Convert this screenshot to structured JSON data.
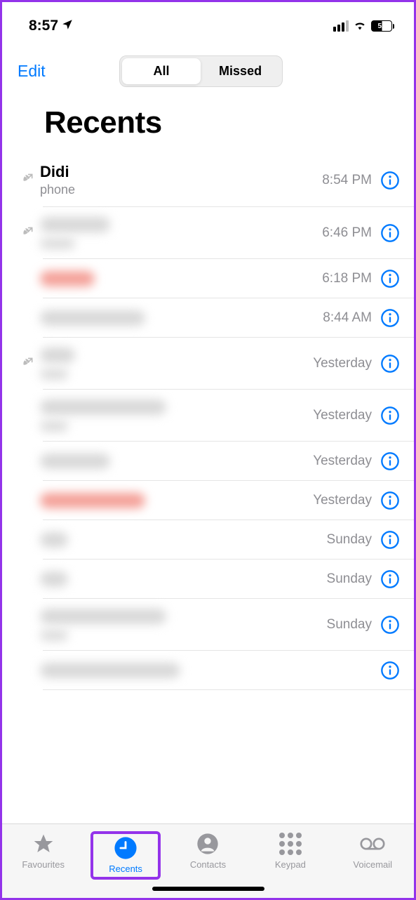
{
  "status_bar": {
    "time": "8:57",
    "battery": "52"
  },
  "header": {
    "edit_label": "Edit",
    "segments": {
      "all": "All",
      "missed": "Missed"
    },
    "title": "Recents"
  },
  "calls": [
    {
      "name": "Didi",
      "sub": "phone",
      "time": "8:54 PM",
      "outgoing": true,
      "missed": false,
      "blurred": false
    },
    {
      "name": "",
      "sub": "",
      "time": "6:46 PM",
      "outgoing": true,
      "missed": false,
      "blurred": true,
      "w1": 100,
      "w2": 50
    },
    {
      "name": "",
      "sub": "",
      "time": "6:18 PM",
      "outgoing": false,
      "missed": true,
      "blurred": true,
      "w1": 78,
      "w2": 0
    },
    {
      "name": "",
      "sub": "",
      "time": "8:44 AM",
      "outgoing": false,
      "missed": false,
      "blurred": true,
      "w1": 150,
      "w2": 0
    },
    {
      "name": "",
      "sub": "",
      "time": "Yesterday",
      "outgoing": true,
      "missed": false,
      "blurred": true,
      "w1": 50,
      "w2": 40
    },
    {
      "name": "",
      "sub": "",
      "time": "Yesterday",
      "outgoing": false,
      "missed": false,
      "blurred": true,
      "w1": 180,
      "w2": 40
    },
    {
      "name": "",
      "sub": "",
      "time": "Yesterday",
      "outgoing": false,
      "missed": false,
      "blurred": true,
      "w1": 100,
      "w2": 0
    },
    {
      "name": "",
      "sub": "",
      "time": "Yesterday",
      "outgoing": false,
      "missed": true,
      "blurred": true,
      "w1": 150,
      "w2": 0
    },
    {
      "name": "",
      "sub": "",
      "time": "Sunday",
      "outgoing": false,
      "missed": false,
      "blurred": true,
      "w1": 40,
      "w2": 0
    },
    {
      "name": "",
      "sub": "",
      "time": "Sunday",
      "outgoing": false,
      "missed": false,
      "blurred": true,
      "w1": 40,
      "w2": 0
    },
    {
      "name": "",
      "sub": "",
      "time": "Sunday",
      "outgoing": false,
      "missed": false,
      "blurred": true,
      "w1": 180,
      "w2": 40
    },
    {
      "name": "",
      "sub": "",
      "time": "",
      "outgoing": false,
      "missed": false,
      "blurred": true,
      "w1": 200,
      "w2": 0
    }
  ],
  "tabs": {
    "favourites": "Favourites",
    "recents": "Recents",
    "contacts": "Contacts",
    "keypad": "Keypad",
    "voicemail": "Voicemail"
  }
}
